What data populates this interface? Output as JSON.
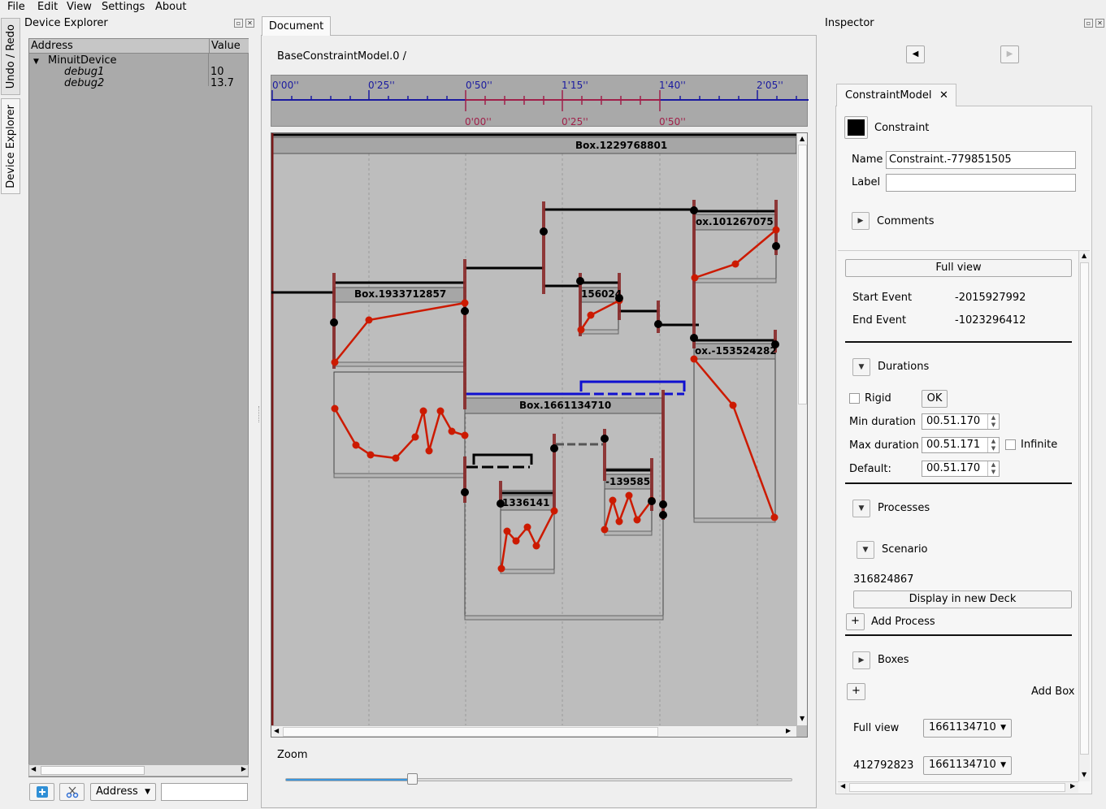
{
  "menu": [
    "File",
    "Edit",
    "View",
    "Settings",
    "About"
  ],
  "side_tabs": {
    "undo_redo": "Undo / Redo",
    "device_explorer": "Device Explorer"
  },
  "device_explorer": {
    "title": "Device Explorer",
    "columns": [
      "Address",
      "Value"
    ],
    "rows": [
      {
        "name": "MinuitDevice",
        "value": ""
      },
      {
        "name": "debug1",
        "value": "10"
      },
      {
        "name": "debug2",
        "value": "13.7"
      }
    ],
    "address_combo": "Address",
    "filter_value": ""
  },
  "document": {
    "tab": "Document",
    "breadcrumb": "BaseConstraintModel.0  /",
    "ruler_top": [
      "0'00''",
      "0'25''",
      "0'50''",
      "1'15''",
      "1'40''",
      "2'05''"
    ],
    "ruler_bottom": [
      "0'00''",
      "0'25''",
      "0'50''"
    ],
    "boxes": {
      "main": "Box.1229768801",
      "b1": "Box.1933712857",
      "b2": "Box.1661134710",
      "b3": "156024",
      "b4": "ox.101267075",
      "b5": "ox.-153524282",
      "b6": "-139585",
      "b7": "1336141"
    },
    "zoom_label": "Zoom",
    "zoom_value": 0.25
  },
  "inspector": {
    "title": "Inspector",
    "tab_label": "ConstraintModel",
    "color_label": "Constraint",
    "color_value": "#000000",
    "name_label": "Name",
    "name_value": "Constraint.-779851505",
    "label_label": "Label",
    "label_value": "",
    "comments": "Comments",
    "full_view": "Full view",
    "start_event_label": "Start Event",
    "start_event": "-2015927992",
    "end_event_label": "End Event",
    "end_event": "-1023296412",
    "durations": "Durations",
    "rigid": "Rigid",
    "ok": "OK",
    "min_label": "Min duration",
    "min_value": "00.51.170",
    "max_label": "Max duration",
    "max_value": "00.51.171",
    "infinite": "Infinite",
    "default_label": "Default:",
    "default_value": "00.51.170",
    "processes": "Processes",
    "scenario": "Scenario",
    "scenario_id": "316824867",
    "display_deck": "Display in new Deck",
    "add_process": "Add Process",
    "plus": "+",
    "boxes": "Boxes",
    "add_box": "Add Box",
    "full_view_label": "Full view",
    "full_view_combo": "1661134710",
    "deck_label": "412792823",
    "deck_combo": "1661134710"
  }
}
